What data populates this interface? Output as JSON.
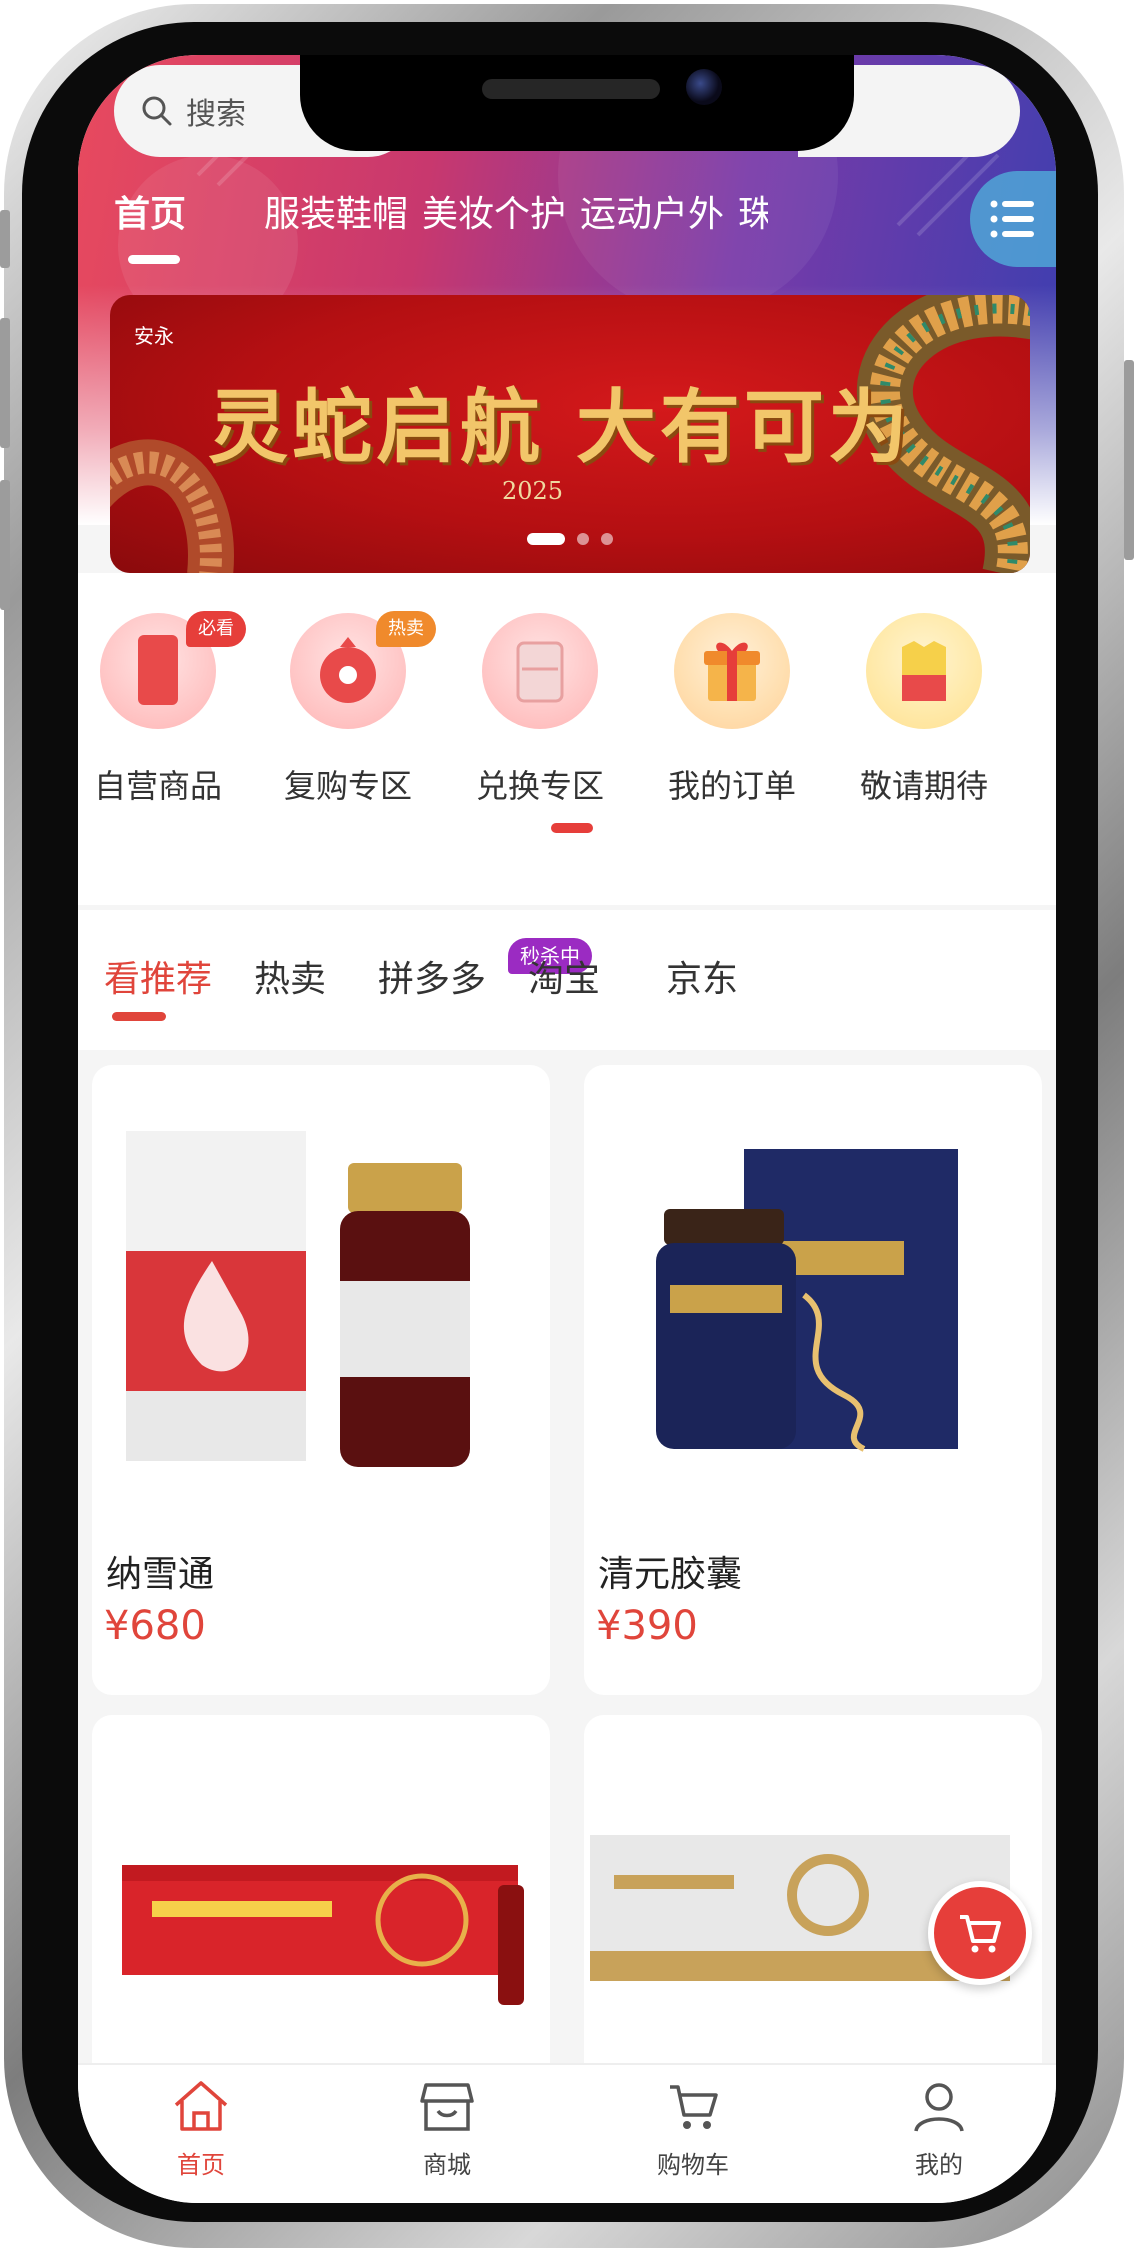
{
  "search": {
    "placeholder": "搜索"
  },
  "category_tabs": [
    "首页",
    "服装鞋帽",
    "美妆个护",
    "运动户外",
    "珠"
  ],
  "banner": {
    "logo_text": "安永",
    "title": "灵蛇启航 大有可为",
    "year": "2025"
  },
  "quick_entries": [
    {
      "label": "自营商品",
      "badge": "必看",
      "badge_color": "#e63e3a"
    },
    {
      "label": "复购专区",
      "badge": "热卖",
      "badge_color": "#f08a2c"
    },
    {
      "label": "兑换专区",
      "badge": "",
      "badge_color": ""
    },
    {
      "label": "我的订单",
      "badge": "",
      "badge_color": ""
    },
    {
      "label": "敬请期待",
      "badge": "",
      "badge_color": ""
    }
  ],
  "product_tabs": [
    "看推荐",
    "热卖",
    "拼多多",
    "淘宝",
    "京东"
  ],
  "flash_badge": "秒杀中",
  "products": [
    {
      "name": "纳雪通",
      "price": "¥680"
    },
    {
      "name": "清元胶囊",
      "price": "¥390"
    }
  ],
  "bottom_nav": [
    "首页",
    "商城",
    "购物车",
    "我的"
  ],
  "colors": {
    "accent": "#e0453b",
    "flash": "#9b2bc2",
    "banner_red": "#b40f12"
  }
}
